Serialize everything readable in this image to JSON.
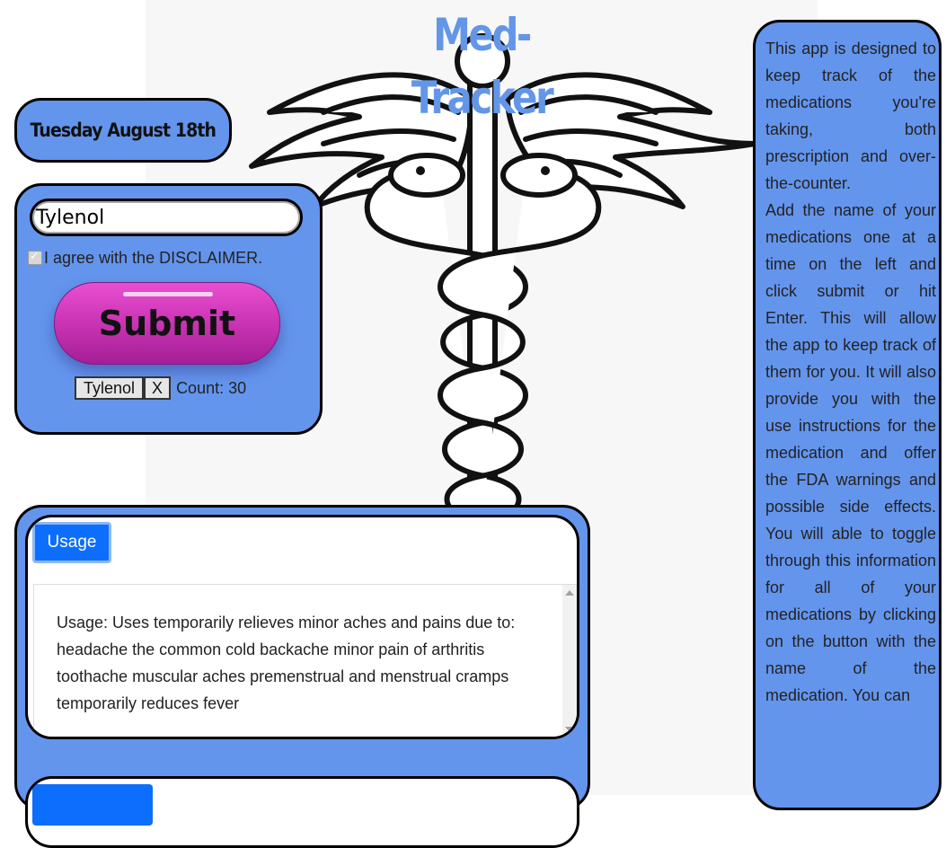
{
  "app": {
    "title": "Med-Tracker",
    "date": "Tuesday August 18th"
  },
  "form": {
    "medication_value": "Tylenol",
    "disclaimer_checked": true,
    "disclaimer_label": "I agree with the DISCLAIMER.",
    "submit_label": "Submit"
  },
  "medications": [
    {
      "name": "Tylenol",
      "remove_label": "X",
      "count_label": "Count: 30"
    }
  ],
  "info": {
    "paragraph1": "This app is designed to keep track of the medications you're taking, both prescription and over-the-counter.",
    "paragraph2": "Add the name of your medications one at a time on the left and click submit or hit Enter. This will allow the app to keep track of them for you. It will also provide you with the use instructions for the medication and offer the FDA warnings and possible side effects. You will able to toggle through this information for all of your medications by clicking on the button with the name of the medication. You can"
  },
  "results": {
    "usage_button": "Usage",
    "usage_text": "Usage: Uses temporarily relieves minor aches and pains due to: headache the common cold backache minor pain of arthritis toothache muscular aches premenstrual and menstrual cramps temporarily reduces fever"
  },
  "colors": {
    "panel_blue": "#6495ed",
    "title_blue": "#6496e8",
    "button_blue": "#0d6efd",
    "submit_pink": "#cd36b8"
  }
}
